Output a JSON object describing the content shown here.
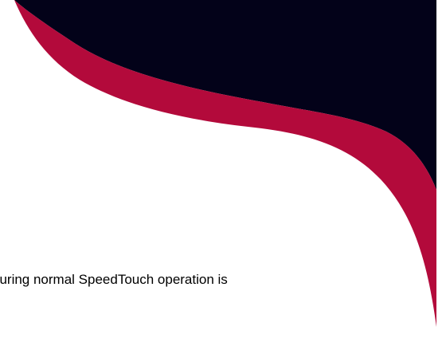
{
  "document": {
    "body_text": "during normal SpeedTouch operation is"
  },
  "theme": {
    "navy": "#030219",
    "crimson": "#b30a3b",
    "background": "#ffffff",
    "text": "#000000"
  }
}
